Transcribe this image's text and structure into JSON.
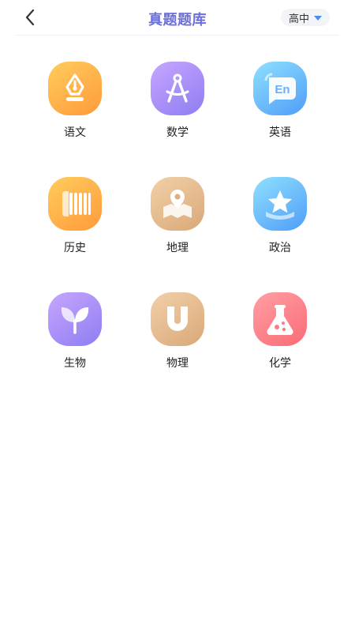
{
  "header": {
    "title": "真题题库",
    "title_color": "#6c6fd8",
    "level": "高中"
  },
  "subjects": [
    {
      "label": "语文",
      "icon": "pen-nib-icon",
      "colors": [
        "#ffcc5c",
        "#ff9a3c"
      ]
    },
    {
      "label": "数学",
      "icon": "compass-icon",
      "colors": [
        "#c6a6ff",
        "#8f7df2"
      ]
    },
    {
      "label": "英语",
      "icon": "en-speech-bubble-icon",
      "colors": [
        "#8fe0ff",
        "#4f9df8"
      ]
    },
    {
      "label": "历史",
      "icon": "scroll-icon",
      "colors": [
        "#ffcc5c",
        "#ff9a3c"
      ]
    },
    {
      "label": "地理",
      "icon": "map-pin-icon",
      "colors": [
        "#f2d0a8",
        "#d9a878"
      ]
    },
    {
      "label": "政治",
      "icon": "star-icon",
      "colors": [
        "#8fe0ff",
        "#4f9df8"
      ]
    },
    {
      "label": "生物",
      "icon": "sprout-icon",
      "colors": [
        "#c6a6ff",
        "#8f7df2"
      ]
    },
    {
      "label": "物理",
      "icon": "magnet-icon",
      "colors": [
        "#f2d0a8",
        "#d9a878"
      ]
    },
    {
      "label": "化学",
      "icon": "flask-icon",
      "colors": [
        "#ff9fa4",
        "#fb6b75"
      ]
    }
  ]
}
